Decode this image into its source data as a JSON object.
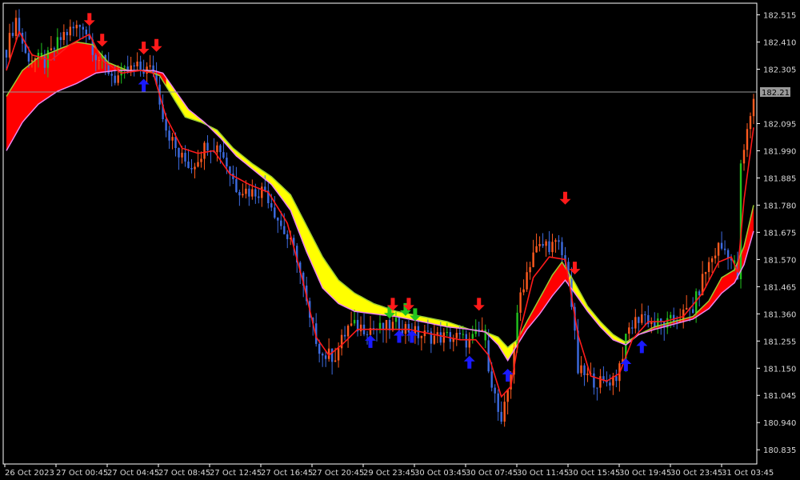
{
  "colors": {
    "background": "#000000",
    "frame": "#ffffff",
    "axis_text": "#d8d8d8",
    "bull_candle": "#ff5a1f",
    "bear_candle": "#3d6be0",
    "signal_candle": "#22c31e",
    "fast_ma": "#ff1a1a",
    "ribbon_down_fill": "#ffff00",
    "ribbon_up_fill": "#ff0000",
    "upper_band_line": "#9acd32",
    "lower_band_line": "#ee82ee",
    "sell_arrow": "#ff1a1a",
    "buy_arrow": "#1a1aff",
    "green_arrow": "#22c31e",
    "current_price_line": "#9a9a9a",
    "current_price_tag_bg": "#9a9a9a"
  },
  "chart_data": {
    "type": "candlestick",
    "instrument_hint": "",
    "y_ticks": [
      "182.515",
      "182.410",
      "182.305",
      "182.095",
      "181.990",
      "181.885",
      "181.780",
      "181.675",
      "181.570",
      "181.465",
      "181.360",
      "181.255",
      "181.150",
      "181.045",
      "180.940",
      "180.835"
    ],
    "ylim": [
      180.78,
      182.56
    ],
    "current_price": "182.217",
    "x_labels": [
      "26 Oct 2023",
      "27 Oct 00:45",
      "27 Oct 04:45",
      "27 Oct 08:45",
      "27 Oct 12:45",
      "27 Oct 16:45",
      "27 Oct 20:45",
      "29 Oct 23:45",
      "30 Oct 03:45",
      "30 Oct 07:45",
      "30 Oct 11:45",
      "30 Oct 15:45",
      "30 Oct 19:45",
      "30 Oct 23:45",
      "31 Oct 03:45"
    ],
    "x_index_range": [
      0,
      234
    ],
    "price_path": [
      [
        0,
        182.38
      ],
      [
        3,
        182.5
      ],
      [
        6,
        182.36
      ],
      [
        12,
        182.33
      ],
      [
        18,
        182.44
      ],
      [
        24,
        182.48
      ],
      [
        28,
        182.36
      ],
      [
        34,
        182.27
      ],
      [
        40,
        182.31
      ],
      [
        46,
        182.3
      ],
      [
        50,
        182.08
      ],
      [
        54,
        181.97
      ],
      [
        58,
        181.93
      ],
      [
        63,
        182.02
      ],
      [
        67,
        182.0
      ],
      [
        72,
        181.85
      ],
      [
        77,
        181.83
      ],
      [
        81,
        181.84
      ],
      [
        86,
        181.7
      ],
      [
        91,
        181.58
      ],
      [
        95,
        181.33
      ],
      [
        99,
        181.2
      ],
      [
        103,
        181.2
      ],
      [
        107,
        181.31
      ],
      [
        111,
        181.31
      ],
      [
        117,
        181.3
      ],
      [
        123,
        181.32
      ],
      [
        129,
        181.28
      ],
      [
        135,
        181.27
      ],
      [
        141,
        181.27
      ],
      [
        145,
        181.25
      ],
      [
        149,
        181.3
      ],
      [
        152,
        181.1
      ],
      [
        155,
        180.92
      ],
      [
        158,
        181.14
      ],
      [
        161,
        181.44
      ],
      [
        165,
        181.6
      ],
      [
        169,
        181.63
      ],
      [
        173,
        181.62
      ],
      [
        176,
        181.52
      ],
      [
        179,
        181.14
      ],
      [
        183,
        181.11
      ],
      [
        187,
        181.09
      ],
      [
        191,
        181.12
      ],
      [
        195,
        181.3
      ],
      [
        199,
        181.36
      ],
      [
        203,
        181.32
      ],
      [
        207,
        181.32
      ],
      [
        211,
        181.35
      ],
      [
        215,
        181.38
      ],
      [
        219,
        181.53
      ],
      [
        223,
        181.62
      ],
      [
        226,
        181.6
      ],
      [
        229,
        181.5
      ],
      [
        230,
        181.92
      ],
      [
        232,
        182.06
      ],
      [
        234,
        182.2
      ]
    ],
    "ma_fast": [
      [
        0,
        182.3
      ],
      [
        4,
        182.45
      ],
      [
        8,
        182.36
      ],
      [
        14,
        182.34
      ],
      [
        20,
        182.4
      ],
      [
        26,
        182.44
      ],
      [
        30,
        182.34
      ],
      [
        36,
        182.29
      ],
      [
        42,
        182.3
      ],
      [
        46,
        182.29
      ],
      [
        50,
        182.12
      ],
      [
        55,
        182.0
      ],
      [
        60,
        181.98
      ],
      [
        65,
        181.99
      ],
      [
        70,
        181.9
      ],
      [
        76,
        181.86
      ],
      [
        82,
        181.83
      ],
      [
        88,
        181.71
      ],
      [
        93,
        181.48
      ],
      [
        97,
        181.27
      ],
      [
        101,
        181.2
      ],
      [
        105,
        181.24
      ],
      [
        110,
        181.3
      ],
      [
        118,
        181.3
      ],
      [
        126,
        181.3
      ],
      [
        134,
        181.28
      ],
      [
        142,
        181.26
      ],
      [
        147,
        181.26
      ],
      [
        151,
        181.2
      ],
      [
        155,
        181.04
      ],
      [
        158,
        181.08
      ],
      [
        161,
        181.3
      ],
      [
        165,
        181.5
      ],
      [
        170,
        181.58
      ],
      [
        175,
        181.57
      ],
      [
        179,
        181.28
      ],
      [
        183,
        181.12
      ],
      [
        188,
        181.1
      ],
      [
        192,
        181.13
      ],
      [
        196,
        181.26
      ],
      [
        201,
        181.33
      ],
      [
        206,
        181.33
      ],
      [
        212,
        181.35
      ],
      [
        218,
        181.44
      ],
      [
        223,
        181.56
      ],
      [
        227,
        181.58
      ],
      [
        229,
        181.52
      ],
      [
        231,
        181.8
      ],
      [
        234,
        182.08
      ]
    ],
    "band_upper": [
      [
        0,
        182.2
      ],
      [
        5,
        182.3
      ],
      [
        10,
        182.35
      ],
      [
        16,
        182.38
      ],
      [
        22,
        182.41
      ],
      [
        27,
        182.4
      ],
      [
        32,
        182.33
      ],
      [
        38,
        182.3
      ],
      [
        44,
        182.3
      ],
      [
        48,
        182.28
      ],
      [
        52,
        182.2
      ],
      [
        56,
        182.12
      ],
      [
        61,
        182.1
      ],
      [
        66,
        182.07
      ],
      [
        71,
        182.0
      ],
      [
        77,
        181.94
      ],
      [
        83,
        181.89
      ],
      [
        89,
        181.82
      ],
      [
        94,
        181.7
      ],
      [
        99,
        181.58
      ],
      [
        104,
        181.49
      ],
      [
        109,
        181.44
      ],
      [
        115,
        181.4
      ],
      [
        122,
        181.37
      ],
      [
        130,
        181.35
      ],
      [
        138,
        181.33
      ],
      [
        145,
        181.3
      ],
      [
        150,
        181.29
      ],
      [
        154,
        181.27
      ],
      [
        157,
        181.23
      ],
      [
        160,
        181.26
      ],
      [
        163,
        181.33
      ],
      [
        167,
        181.42
      ],
      [
        171,
        181.51
      ],
      [
        174,
        181.56
      ],
      [
        178,
        181.48
      ],
      [
        182,
        181.39
      ],
      [
        186,
        181.33
      ],
      [
        190,
        181.28
      ],
      [
        194,
        181.25
      ],
      [
        198,
        181.28
      ],
      [
        203,
        181.31
      ],
      [
        209,
        181.33
      ],
      [
        215,
        181.35
      ],
      [
        220,
        181.41
      ],
      [
        224,
        181.5
      ],
      [
        228,
        181.53
      ],
      [
        231,
        181.62
      ],
      [
        234,
        181.78
      ]
    ],
    "band_lower": [
      [
        0,
        181.99
      ],
      [
        5,
        182.1
      ],
      [
        10,
        182.17
      ],
      [
        16,
        182.22
      ],
      [
        22,
        182.25
      ],
      [
        28,
        182.29
      ],
      [
        34,
        182.3
      ],
      [
        40,
        182.3
      ],
      [
        46,
        182.3
      ],
      [
        49,
        182.29
      ],
      [
        53,
        182.22
      ],
      [
        57,
        182.15
      ],
      [
        62,
        182.1
      ],
      [
        67,
        182.04
      ],
      [
        72,
        181.97
      ],
      [
        77,
        181.92
      ],
      [
        83,
        181.86
      ],
      [
        89,
        181.76
      ],
      [
        94,
        181.6
      ],
      [
        99,
        181.46
      ],
      [
        104,
        181.4
      ],
      [
        109,
        181.37
      ],
      [
        115,
        181.36
      ],
      [
        122,
        181.35
      ],
      [
        130,
        181.33
      ],
      [
        138,
        181.31
      ],
      [
        145,
        181.3
      ],
      [
        150,
        181.29
      ],
      [
        154,
        181.24
      ],
      [
        157,
        181.18
      ],
      [
        160,
        181.24
      ],
      [
        163,
        181.3
      ],
      [
        167,
        181.36
      ],
      [
        171,
        181.43
      ],
      [
        175,
        181.49
      ],
      [
        178,
        181.44
      ],
      [
        182,
        181.37
      ],
      [
        186,
        181.31
      ],
      [
        190,
        181.26
      ],
      [
        194,
        181.24
      ],
      [
        198,
        181.28
      ],
      [
        203,
        181.3
      ],
      [
        209,
        181.32
      ],
      [
        215,
        181.34
      ],
      [
        220,
        181.38
      ],
      [
        224,
        181.44
      ],
      [
        228,
        181.48
      ],
      [
        231,
        181.55
      ],
      [
        234,
        181.68
      ]
    ],
    "ribbon_up_ranges": [
      [
        0,
        50
      ],
      [
        160,
        176
      ],
      [
        195,
        234
      ]
    ],
    "signals": [
      {
        "type": "sell",
        "i": 26,
        "price": 182.5
      },
      {
        "type": "sell",
        "i": 30,
        "price": 182.42
      },
      {
        "type": "sell",
        "i": 43,
        "price": 182.39
      },
      {
        "type": "sell",
        "i": 47,
        "price": 182.4
      },
      {
        "type": "buy",
        "i": 43,
        "price": 182.24
      },
      {
        "type": "buy",
        "i": 114,
        "price": 181.25
      },
      {
        "type": "buy",
        "i": 123,
        "price": 181.27
      },
      {
        "type": "buy",
        "i": 127,
        "price": 181.27
      },
      {
        "type": "green",
        "i": 120,
        "price": 181.37
      },
      {
        "type": "green",
        "i": 125,
        "price": 181.38
      },
      {
        "type": "green",
        "i": 128,
        "price": 181.36
      },
      {
        "type": "sell",
        "i": 121,
        "price": 181.4
      },
      {
        "type": "sell",
        "i": 126,
        "price": 181.4
      },
      {
        "type": "sell",
        "i": 148,
        "price": 181.4
      },
      {
        "type": "buy",
        "i": 145,
        "price": 181.17
      },
      {
        "type": "buy",
        "i": 157,
        "price": 181.12
      },
      {
        "type": "sell",
        "i": 175,
        "price": 181.81
      },
      {
        "type": "sell",
        "i": 178,
        "price": 181.54
      },
      {
        "type": "buy",
        "i": 194,
        "price": 181.16
      },
      {
        "type": "buy",
        "i": 199,
        "price": 181.23
      }
    ]
  }
}
